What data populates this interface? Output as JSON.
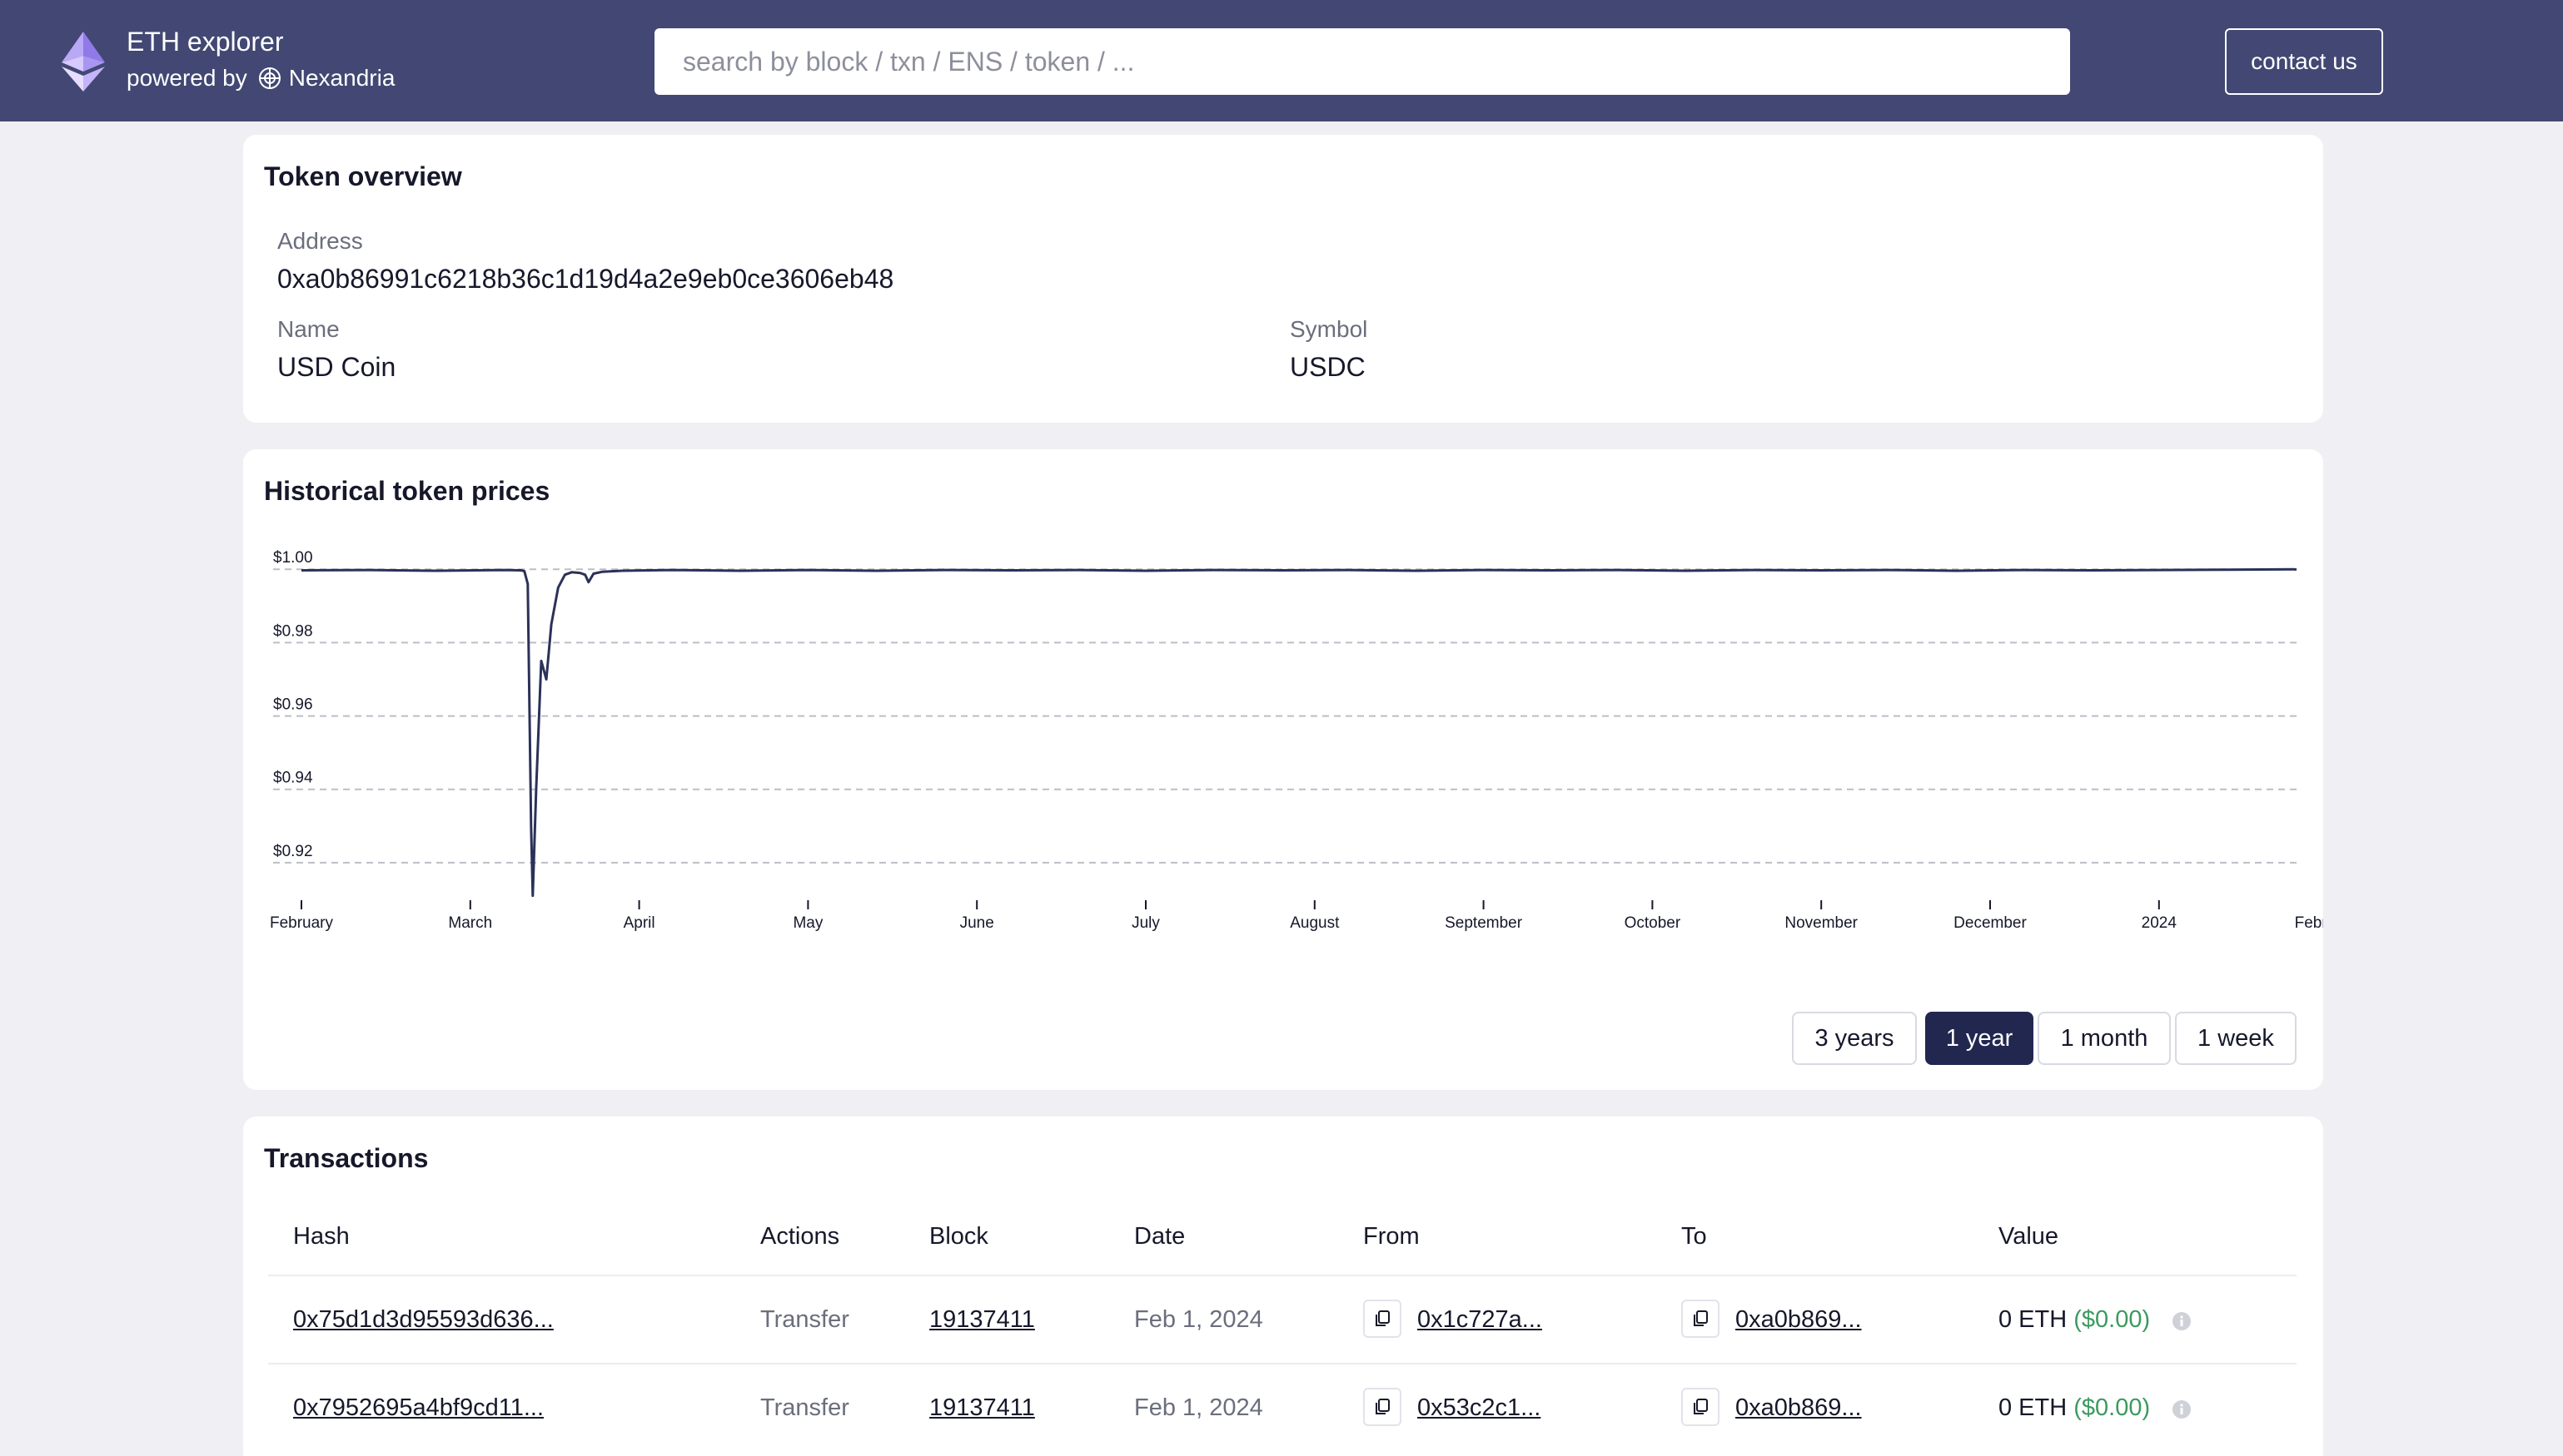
{
  "header": {
    "app_title": "ETH explorer",
    "powered_by": "powered by",
    "partner": "Nexandria",
    "search_placeholder": "search by block / txn / ENS / token / ...",
    "contact_label": "contact us",
    "bg_color": "#424873"
  },
  "overview": {
    "title": "Token overview",
    "address_label": "Address",
    "address_value": "0xa0b86991c6218b36c1d19d4a2e9eb0ce3606eb48",
    "name_label": "Name",
    "name_value": "USD Coin",
    "symbol_label": "Symbol",
    "symbol_value": "USDC"
  },
  "prices": {
    "title": "Historical token prices",
    "range_buttons": [
      {
        "label": "3 years",
        "active": false
      },
      {
        "label": "1 year",
        "active": true
      },
      {
        "label": "1 month",
        "active": false
      },
      {
        "label": "1 week",
        "active": false
      }
    ]
  },
  "chart_data": {
    "type": "line",
    "title": "",
    "xlabel": "",
    "ylabel": "",
    "x_tick_labels": [
      "February",
      "March",
      "April",
      "May",
      "June",
      "July",
      "August",
      "September",
      "October",
      "November",
      "December",
      "2024",
      "Febru"
    ],
    "y_tick_labels": [
      "$1.00",
      "$0.98",
      "$0.96",
      "$0.94",
      "$0.92"
    ],
    "y_ticks": [
      1.0,
      0.98,
      0.96,
      0.94,
      0.92
    ],
    "ylim": [
      0.91,
      1.003
    ],
    "x_range_months": [
      0,
      12.1
    ],
    "grid": true,
    "line_color": "#2b3158",
    "series": [
      {
        "points": [
          [
            0.0,
            0.9997
          ],
          [
            0.4,
            0.9998
          ],
          [
            0.8,
            0.9996
          ],
          [
            1.2,
            0.9998
          ],
          [
            1.3,
            0.9997
          ],
          [
            1.32,
            0.9995
          ],
          [
            1.34,
            0.996
          ],
          [
            1.36,
            0.93
          ],
          [
            1.37,
            0.911
          ],
          [
            1.39,
            0.94
          ],
          [
            1.42,
            0.975
          ],
          [
            1.45,
            0.97
          ],
          [
            1.48,
            0.985
          ],
          [
            1.52,
            0.995
          ],
          [
            1.56,
            0.9985
          ],
          [
            1.6,
            0.9992
          ],
          [
            1.65,
            0.999
          ],
          [
            1.68,
            0.9985
          ],
          [
            1.7,
            0.9965
          ],
          [
            1.73,
            0.9988
          ],
          [
            1.78,
            0.9993
          ],
          [
            1.9,
            0.9996
          ],
          [
            2.2,
            0.9998
          ],
          [
            2.6,
            0.9996
          ],
          [
            3.0,
            0.9998
          ],
          [
            3.4,
            0.9996
          ],
          [
            3.8,
            0.9998
          ],
          [
            4.2,
            0.9997
          ],
          [
            4.6,
            0.9998
          ],
          [
            5.0,
            0.9996
          ],
          [
            5.4,
            0.9998
          ],
          [
            5.8,
            0.9997
          ],
          [
            6.2,
            0.9998
          ],
          [
            6.6,
            0.9996
          ],
          [
            7.0,
            0.9998
          ],
          [
            7.4,
            0.9997
          ],
          [
            7.8,
            0.9998
          ],
          [
            8.2,
            0.9996
          ],
          [
            8.6,
            0.9998
          ],
          [
            9.0,
            0.9997
          ],
          [
            9.4,
            0.9998
          ],
          [
            9.8,
            0.9996
          ],
          [
            10.2,
            0.9998
          ],
          [
            10.6,
            0.9997
          ],
          [
            11.0,
            0.9998
          ],
          [
            11.4,
            0.9999
          ],
          [
            11.8,
            1.0
          ],
          [
            12.1,
            0.9999
          ]
        ]
      }
    ]
  },
  "transactions": {
    "title": "Transactions",
    "columns": [
      "Hash",
      "Actions",
      "Block",
      "Date",
      "From",
      "To",
      "Value"
    ],
    "rows": [
      {
        "hash": "0x75d1d3d95593d636...",
        "action": "Transfer",
        "block": "19137411",
        "date": "Feb 1, 2024",
        "from": "0x1c727a...",
        "to": "0xa0b869...",
        "value_eth": "0 ETH",
        "value_usd": "($0.00)"
      },
      {
        "hash": "0x7952695a4bf9cd11...",
        "action": "Transfer",
        "block": "19137411",
        "date": "Feb 1, 2024",
        "from": "0x53c2c1...",
        "to": "0xa0b869...",
        "value_eth": "0 ETH",
        "value_usd": "($0.00)"
      }
    ]
  }
}
